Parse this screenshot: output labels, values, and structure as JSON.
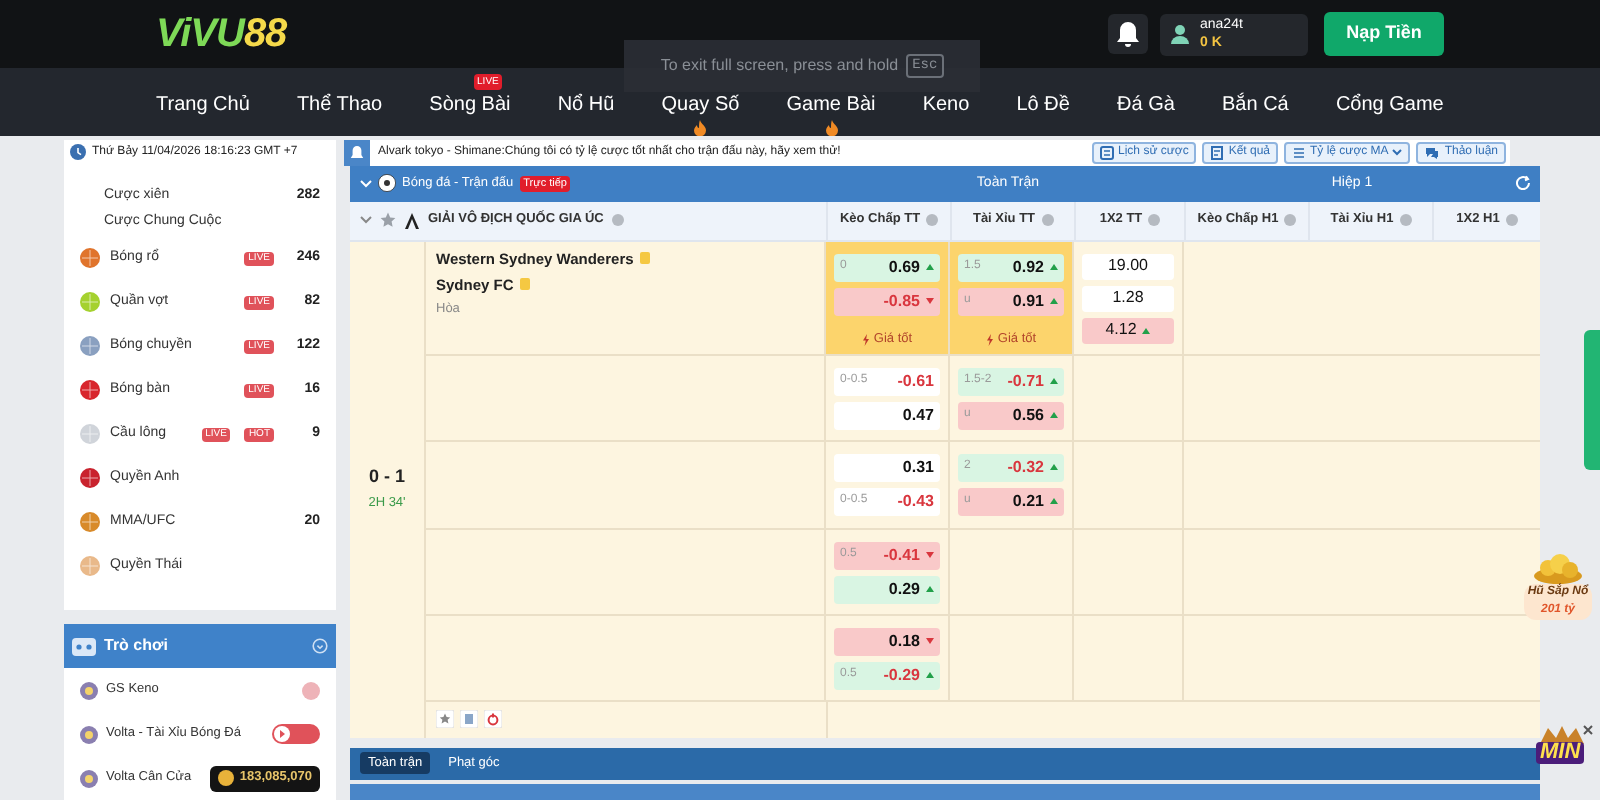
{
  "header": {
    "logo": {
      "part_1": "ViVU",
      "part_2": "88"
    },
    "user": {
      "name": "ana24t",
      "balance": "0 K"
    },
    "deposit_button": "Nạp Tiền"
  },
  "fullscreen_notice": {
    "text": "To exit full screen, press and hold",
    "key": "Esc"
  },
  "nav": [
    {
      "label": "Trang Chủ",
      "selected": false,
      "hot": false
    },
    {
      "label": "Thể Thao",
      "selected": false,
      "hot": false
    },
    {
      "label": "Sòng Bài",
      "selected": false,
      "hot": false,
      "badge": "LIVE"
    },
    {
      "label": "Nổ Hũ",
      "selected": false,
      "hot": false
    },
    {
      "label": "Quay Số",
      "selected": false,
      "hot": true
    },
    {
      "label": "Game Bài",
      "selected": false,
      "hot": true
    },
    {
      "label": "Keno",
      "selected": false,
      "hot": false
    },
    {
      "label": "Lô Đề",
      "selected": false,
      "hot": false
    },
    {
      "label": "Đá Gà",
      "selected": false,
      "hot": false
    },
    {
      "label": "Bắn Cá",
      "selected": false,
      "hot": false
    },
    {
      "label": "Cổng Game",
      "selected": false,
      "hot": false
    }
  ],
  "info_bar": {
    "datetime": "Thứ Bảy 11/04/2026 18:16:23 GMT +7",
    "ticker": "Alvark tokyo - Shimane:Chúng tôi có tỷ lệ cược tốt nhất cho trận đấu này, hãy xem thử!",
    "buttons": [
      {
        "label": "Lịch sử cược",
        "kind": "history"
      },
      {
        "label": "Kết quả",
        "kind": "results"
      },
      {
        "label": "Tỷ lệ cược MA",
        "kind": "odds"
      },
      {
        "label": "Thảo luận",
        "kind": "chat"
      }
    ]
  },
  "sidebar": {
    "items": [
      {
        "kind": "sub",
        "label": "Cược xiên",
        "count": "282"
      },
      {
        "kind": "sub",
        "label": "Cược Chung Cuộc"
      },
      {
        "kind": "sport",
        "label": "Bóng rổ",
        "badges": [
          "LIVE"
        ],
        "count": "246"
      },
      {
        "kind": "sport",
        "label": "Quần vợt",
        "badges": [
          "LIVE"
        ],
        "count": "82"
      },
      {
        "kind": "sport",
        "label": "Bóng chuyền",
        "badges": [
          "LIVE"
        ],
        "count": "122"
      },
      {
        "kind": "sport",
        "label": "Bóng bàn",
        "badges": [
          "LIVE"
        ],
        "count": "16"
      },
      {
        "kind": "sport",
        "label": "Cầu lông",
        "badges": [
          "LIVE",
          "HOT"
        ],
        "count": "9"
      },
      {
        "kind": "sport",
        "label": "Quyền Anh"
      },
      {
        "kind": "sport",
        "label": "MMA/UFC",
        "count": "20"
      },
      {
        "kind": "sport",
        "label": "Quyền Thái"
      }
    ]
  },
  "games": {
    "title": "Trò chơi",
    "items": [
      {
        "label": "GS Keno",
        "kind": "keno"
      },
      {
        "label": "Volta - Tài Xỉu Bóng Đá",
        "kind": "play"
      },
      {
        "label": "Volta Cân Cửa",
        "kind": "jackpot",
        "amount": "183,085,070"
      }
    ]
  },
  "market": {
    "sport": "Bóng đá - Trận đấu",
    "live_badge": "Trực tiếp",
    "sections": [
      "Toàn Trận",
      "Hiệp 1"
    ],
    "league": "GIẢI VÔ ĐỊCH QUỐC GIA ÚC",
    "columns": [
      "Kèo Chấp TT",
      "Tài Xỉu TT",
      "1X2 TT",
      "Kèo Chấp H1",
      "Tài Xỉu H1",
      "1X2 H1"
    ],
    "match": {
      "score": "0 - 1",
      "time": "2H 34'",
      "home": "Western Sydney Wanderers",
      "away": "Sydney FC",
      "draw": "Hòa"
    },
    "rows": [
      {
        "handicap_best_price": "Giá tốt",
        "over_under_best_price": "Giá tốt",
        "handicap": [
          {
            "line": "0",
            "value": "0.69",
            "negative": false,
            "rising": true,
            "falling": false,
            "color": "#d9f5e3"
          },
          {
            "value": "-0.85",
            "negative": true,
            "rising": false,
            "falling": true,
            "color": "#f9c9c9"
          }
        ],
        "over_under": [
          {
            "line": "1.5",
            "value": "0.92",
            "negative": false,
            "rising": true,
            "falling": false,
            "color": "#d9f5e3"
          },
          {
            "line": "u",
            "value": "0.91",
            "negative": false,
            "rising": true,
            "falling": false,
            "color": "#f9c9c9"
          }
        ],
        "result": [
          {
            "value": "19.00",
            "negative": false,
            "rising": false,
            "falling": false,
            "color": "#ffffff"
          },
          {
            "value": "1.28",
            "negative": false,
            "rising": false,
            "falling": false,
            "color": "#ffffff"
          },
          {
            "value": "4.12",
            "negative": false,
            "rising": true,
            "falling": false,
            "color": "#f9c9c9"
          }
        ]
      },
      {
        "handicap": [
          {
            "line": "0-0.5",
            "value": "-0.61",
            "negative": true,
            "rising": false,
            "falling": false,
            "color": "#ffffff"
          },
          {
            "value": "0.47",
            "negative": false,
            "rising": false,
            "falling": false,
            "color": "#ffffff"
          }
        ],
        "over_under": [
          {
            "line": "1.5-2",
            "value": "-0.71",
            "negative": true,
            "rising": true,
            "falling": false,
            "color": "#d9f5e3"
          },
          {
            "line": "u",
            "value": "0.56",
            "negative": false,
            "rising": true,
            "falling": false,
            "color": "#f9c9c9"
          }
        ]
      },
      {
        "handicap": [
          {
            "value": "0.31",
            "negative": false,
            "rising": false,
            "falling": false,
            "color": "#ffffff"
          },
          {
            "line": "0-0.5",
            "value": "-0.43",
            "negative": true,
            "rising": false,
            "falling": false,
            "color": "#ffffff"
          }
        ],
        "over_under": [
          {
            "line": "2",
            "value": "-0.32",
            "negative": true,
            "rising": true,
            "falling": false,
            "color": "#d9f5e3"
          },
          {
            "line": "u",
            "value": "0.21",
            "negative": false,
            "rising": true,
            "falling": false,
            "color": "#f9c9c9"
          }
        ]
      },
      {
        "handicap": [
          {
            "line": "0.5",
            "value": "-0.41",
            "negative": true,
            "rising": false,
            "falling": true,
            "color": "#f9c9c9"
          },
          {
            "value": "0.29",
            "negative": false,
            "rising": true,
            "falling": false,
            "color": "#d9f5e3"
          }
        ]
      },
      {
        "handicap": [
          {
            "value": "0.18",
            "negative": false,
            "rising": false,
            "falling": true,
            "color": "#f9c9c9"
          },
          {
            "line": "0.5",
            "value": "-0.29",
            "negative": true,
            "rising": true,
            "falling": false,
            "color": "#d9f5e3"
          }
        ]
      }
    ]
  },
  "bottom_tabs": [
    {
      "label": "Toàn trận",
      "selected": true
    },
    {
      "label": "Phạt góc",
      "selected": false
    }
  ],
  "jackpot": {
    "title": "Hũ Sắp Nổ",
    "amount": "201 tỷ"
  },
  "mini_game": {
    "text": "MIN"
  }
}
